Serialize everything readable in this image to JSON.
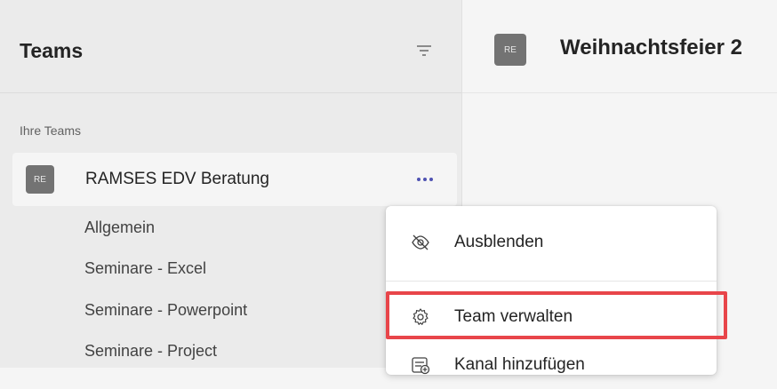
{
  "sidebar": {
    "title": "Teams",
    "filter_icon": "filter-icon",
    "section_label": "Ihre Teams",
    "team": {
      "avatar": "RE",
      "name": "RAMSES EDV Beratung",
      "more_icon": "more-options-icon"
    },
    "channels": [
      "Allgemein",
      "Seminare - Excel",
      "Seminare - Powerpoint",
      "Seminare - Project"
    ]
  },
  "main": {
    "avatar": "RE",
    "title": "Weihnachtsfeier 2"
  },
  "context_menu": {
    "items": [
      {
        "label": "Ausblenden",
        "icon": "hide-icon"
      },
      {
        "label": "Team verwalten",
        "icon": "gear-icon"
      },
      {
        "label": "Kanal hinzufügen",
        "icon": "add-channel-icon"
      }
    ],
    "highlight_color": "#e8454a"
  },
  "colors": {
    "accent": "#4f52b2",
    "avatar_bg": "#737373"
  }
}
